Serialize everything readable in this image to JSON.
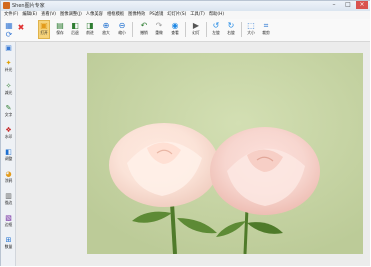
{
  "window": {
    "title": "Shen图片专家",
    "minimize": "–",
    "maximize": "□",
    "close": "×"
  },
  "menu": [
    "文件(F)",
    "编辑(E)",
    "查看(V)",
    "图像调整(J)",
    "人像美容",
    "相框模板",
    "图像特效",
    "PS滤镜",
    "幻灯片(S)",
    "工具(T)",
    "帮助(H)"
  ],
  "toolbar": {
    "open": "打开",
    "save": "保存",
    "back": "后退",
    "forward": "前进",
    "zoom_in": "放大",
    "zoom_out": "缩小",
    "undo": "撤销",
    "redo": "重做",
    "view": "查看",
    "slideshow": "幻灯",
    "rotate_left": "左旋",
    "rotate_right": "右旋",
    "resize": "大小",
    "crop": "裁剪"
  },
  "sidebar": [
    "补光",
    "减光",
    "文字",
    "水印",
    "调整",
    "涂鸦",
    "描边",
    "边框",
    "数量"
  ],
  "colors": {
    "accent": "#f6d37a",
    "photo_bg": "#c9d7a7"
  }
}
